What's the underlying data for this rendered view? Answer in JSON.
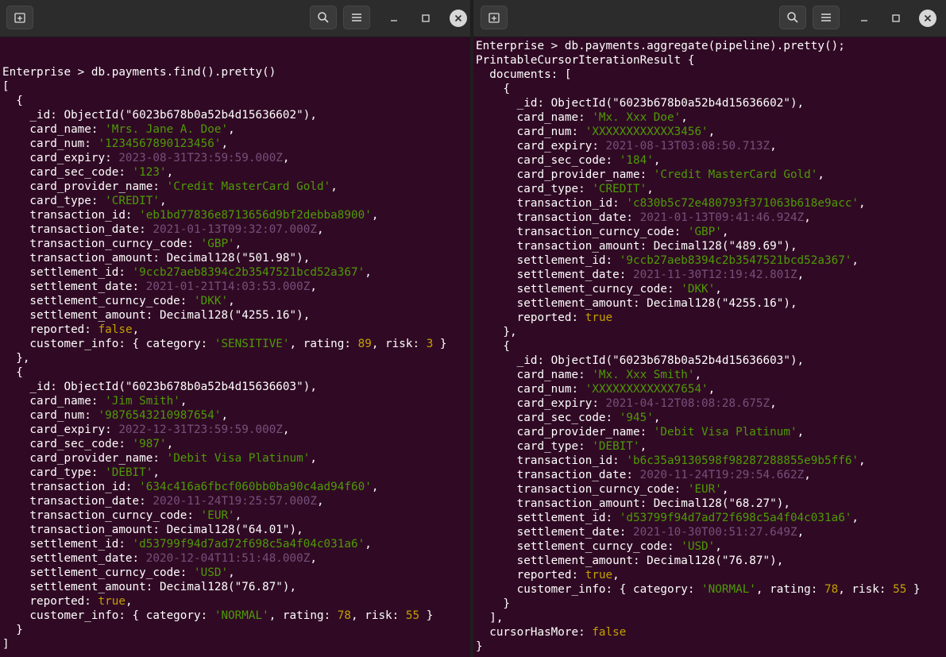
{
  "colors": {
    "terminal_bg": "#300a24",
    "string": "#4e9a06",
    "date": "#75507b",
    "number_bool": "#c4a000",
    "text": "#ffffff",
    "titlebar": "#2c2c2c"
  },
  "icons": [
    "new-tab-icon",
    "search-icon",
    "hamburger-menu-icon",
    "minimize-icon",
    "maximize-icon",
    "close-icon"
  ],
  "left_terminal": {
    "lines": [
      [],
      [
        {
          "t": "Enterprise > db.payments.find().pretty()"
        }
      ],
      [
        {
          "t": "["
        }
      ],
      [
        {
          "t": "  {"
        }
      ],
      [
        {
          "t": "    _id: ObjectId(\"6023b678b0a52b4d15636602\"),"
        }
      ],
      [
        {
          "t": "    card_name: "
        },
        {
          "t": "'Mrs. Jane A. Doe'",
          "c": "s"
        },
        {
          "t": ","
        }
      ],
      [
        {
          "t": "    card_num: "
        },
        {
          "t": "'1234567890123456'",
          "c": "s"
        },
        {
          "t": ","
        }
      ],
      [
        {
          "t": "    card_expiry: "
        },
        {
          "t": "2023-08-31T23:59:59.000Z",
          "c": "d"
        },
        {
          "t": ","
        }
      ],
      [
        {
          "t": "    card_sec_code: "
        },
        {
          "t": "'123'",
          "c": "s"
        },
        {
          "t": ","
        }
      ],
      [
        {
          "t": "    card_provider_name: "
        },
        {
          "t": "'Credit MasterCard Gold'",
          "c": "s"
        },
        {
          "t": ","
        }
      ],
      [
        {
          "t": "    card_type: "
        },
        {
          "t": "'CREDIT'",
          "c": "s"
        },
        {
          "t": ","
        }
      ],
      [
        {
          "t": "    transaction_id: "
        },
        {
          "t": "'eb1bd77836e8713656d9bf2debba8900'",
          "c": "s"
        },
        {
          "t": ","
        }
      ],
      [
        {
          "t": "    transaction_date: "
        },
        {
          "t": "2021-01-13T09:32:07.000Z",
          "c": "d"
        },
        {
          "t": ","
        }
      ],
      [
        {
          "t": "    transaction_curncy_code: "
        },
        {
          "t": "'GBP'",
          "c": "s"
        },
        {
          "t": ","
        }
      ],
      [
        {
          "t": "    transaction_amount: Decimal128(\"501.98\"),"
        }
      ],
      [
        {
          "t": "    settlement_id: "
        },
        {
          "t": "'9ccb27aeb8394c2b3547521bcd52a367'",
          "c": "s"
        },
        {
          "t": ","
        }
      ],
      [
        {
          "t": "    settlement_date: "
        },
        {
          "t": "2021-01-21T14:03:53.000Z",
          "c": "d"
        },
        {
          "t": ","
        }
      ],
      [
        {
          "t": "    settlement_curncy_code: "
        },
        {
          "t": "'DKK'",
          "c": "s"
        },
        {
          "t": ","
        }
      ],
      [
        {
          "t": "    settlement_amount: Decimal128(\"4255.16\"),"
        }
      ],
      [
        {
          "t": "    reported: "
        },
        {
          "t": "false",
          "c": "n"
        },
        {
          "t": ","
        }
      ],
      [
        {
          "t": "    customer_info: { category: "
        },
        {
          "t": "'SENSITIVE'",
          "c": "s"
        },
        {
          "t": ", rating: "
        },
        {
          "t": "89",
          "c": "n"
        },
        {
          "t": ", risk: "
        },
        {
          "t": "3",
          "c": "n"
        },
        {
          "t": " }"
        }
      ],
      [
        {
          "t": "  },"
        }
      ],
      [
        {
          "t": "  {"
        }
      ],
      [
        {
          "t": "    _id: ObjectId(\"6023b678b0a52b4d15636603\"),"
        }
      ],
      [
        {
          "t": "    card_name: "
        },
        {
          "t": "'Jim Smith'",
          "c": "s"
        },
        {
          "t": ","
        }
      ],
      [
        {
          "t": "    card_num: "
        },
        {
          "t": "'9876543210987654'",
          "c": "s"
        },
        {
          "t": ","
        }
      ],
      [
        {
          "t": "    card_expiry: "
        },
        {
          "t": "2022-12-31T23:59:59.000Z",
          "c": "d"
        },
        {
          "t": ","
        }
      ],
      [
        {
          "t": "    card_sec_code: "
        },
        {
          "t": "'987'",
          "c": "s"
        },
        {
          "t": ","
        }
      ],
      [
        {
          "t": "    card_provider_name: "
        },
        {
          "t": "'Debit Visa Platinum'",
          "c": "s"
        },
        {
          "t": ","
        }
      ],
      [
        {
          "t": "    card_type: "
        },
        {
          "t": "'DEBIT'",
          "c": "s"
        },
        {
          "t": ","
        }
      ],
      [
        {
          "t": "    transaction_id: "
        },
        {
          "t": "'634c416a6fbcf060bb0ba90c4ad94f60'",
          "c": "s"
        },
        {
          "t": ","
        }
      ],
      [
        {
          "t": "    transaction_date: "
        },
        {
          "t": "2020-11-24T19:25:57.000Z",
          "c": "d"
        },
        {
          "t": ","
        }
      ],
      [
        {
          "t": "    transaction_curncy_code: "
        },
        {
          "t": "'EUR'",
          "c": "s"
        },
        {
          "t": ","
        }
      ],
      [
        {
          "t": "    transaction_amount: Decimal128(\"64.01\"),"
        }
      ],
      [
        {
          "t": "    settlement_id: "
        },
        {
          "t": "'d53799f94d7ad72f698c5a4f04c031a6'",
          "c": "s"
        },
        {
          "t": ","
        }
      ],
      [
        {
          "t": "    settlement_date: "
        },
        {
          "t": "2020-12-04T11:51:48.000Z",
          "c": "d"
        },
        {
          "t": ","
        }
      ],
      [
        {
          "t": "    settlement_curncy_code: "
        },
        {
          "t": "'USD'",
          "c": "s"
        },
        {
          "t": ","
        }
      ],
      [
        {
          "t": "    settlement_amount: Decimal128(\"76.87\"),"
        }
      ],
      [
        {
          "t": "    reported: "
        },
        {
          "t": "true",
          "c": "n"
        },
        {
          "t": ","
        }
      ],
      [
        {
          "t": "    customer_info: { category: "
        },
        {
          "t": "'NORMAL'",
          "c": "s"
        },
        {
          "t": ", rating: "
        },
        {
          "t": "78",
          "c": "n"
        },
        {
          "t": ", risk: "
        },
        {
          "t": "55",
          "c": "n"
        },
        {
          "t": " }"
        }
      ],
      [
        {
          "t": "  }"
        }
      ],
      [
        {
          "t": "]"
        }
      ]
    ]
  },
  "right_terminal": {
    "lines": [
      [
        {
          "t": "Enterprise > db.payments.aggregate(pipeline).pretty();"
        }
      ],
      [
        {
          "t": "PrintableCursorIterationResult {"
        }
      ],
      [
        {
          "t": "  documents: ["
        }
      ],
      [
        {
          "t": "    {"
        }
      ],
      [
        {
          "t": "      _id: ObjectId(\"6023b678b0a52b4d15636602\"),"
        }
      ],
      [
        {
          "t": "      card_name: "
        },
        {
          "t": "'Mx. Xxx Doe'",
          "c": "s"
        },
        {
          "t": ","
        }
      ],
      [
        {
          "t": "      card_num: "
        },
        {
          "t": "'XXXXXXXXXXXX3456'",
          "c": "s"
        },
        {
          "t": ","
        }
      ],
      [
        {
          "t": "      card_expiry: "
        },
        {
          "t": "2021-08-13T03:08:50.713Z",
          "c": "d"
        },
        {
          "t": ","
        }
      ],
      [
        {
          "t": "      card_sec_code: "
        },
        {
          "t": "'184'",
          "c": "s"
        },
        {
          "t": ","
        }
      ],
      [
        {
          "t": "      card_provider_name: "
        },
        {
          "t": "'Credit MasterCard Gold'",
          "c": "s"
        },
        {
          "t": ","
        }
      ],
      [
        {
          "t": "      card_type: "
        },
        {
          "t": "'CREDIT'",
          "c": "s"
        },
        {
          "t": ","
        }
      ],
      [
        {
          "t": "      transaction_id: "
        },
        {
          "t": "'c830b5c72e480793f371063b618e9acc'",
          "c": "s"
        },
        {
          "t": ","
        }
      ],
      [
        {
          "t": "      transaction_date: "
        },
        {
          "t": "2021-01-13T09:41:46.924Z",
          "c": "d"
        },
        {
          "t": ","
        }
      ],
      [
        {
          "t": "      transaction_curncy_code: "
        },
        {
          "t": "'GBP'",
          "c": "s"
        },
        {
          "t": ","
        }
      ],
      [
        {
          "t": "      transaction_amount: Decimal128(\"489.69\"),"
        }
      ],
      [
        {
          "t": "      settlement_id: "
        },
        {
          "t": "'9ccb27aeb8394c2b3547521bcd52a367'",
          "c": "s"
        },
        {
          "t": ","
        }
      ],
      [
        {
          "t": "      settlement_date: "
        },
        {
          "t": "2021-11-30T12:19:42.801Z",
          "c": "d"
        },
        {
          "t": ","
        }
      ],
      [
        {
          "t": "      settlement_curncy_code: "
        },
        {
          "t": "'DKK'",
          "c": "s"
        },
        {
          "t": ","
        }
      ],
      [
        {
          "t": "      settlement_amount: Decimal128(\"4255.16\"),"
        }
      ],
      [
        {
          "t": "      reported: "
        },
        {
          "t": "true",
          "c": "n"
        }
      ],
      [
        {
          "t": "    },"
        }
      ],
      [
        {
          "t": "    {"
        }
      ],
      [
        {
          "t": "      _id: ObjectId(\"6023b678b0a52b4d15636603\"),"
        }
      ],
      [
        {
          "t": "      card_name: "
        },
        {
          "t": "'Mx. Xxx Smith'",
          "c": "s"
        },
        {
          "t": ","
        }
      ],
      [
        {
          "t": "      card_num: "
        },
        {
          "t": "'XXXXXXXXXXXX7654'",
          "c": "s"
        },
        {
          "t": ","
        }
      ],
      [
        {
          "t": "      card_expiry: "
        },
        {
          "t": "2021-04-12T08:08:28.675Z",
          "c": "d"
        },
        {
          "t": ","
        }
      ],
      [
        {
          "t": "      card_sec_code: "
        },
        {
          "t": "'945'",
          "c": "s"
        },
        {
          "t": ","
        }
      ],
      [
        {
          "t": "      card_provider_name: "
        },
        {
          "t": "'Debit Visa Platinum'",
          "c": "s"
        },
        {
          "t": ","
        }
      ],
      [
        {
          "t": "      card_type: "
        },
        {
          "t": "'DEBIT'",
          "c": "s"
        },
        {
          "t": ","
        }
      ],
      [
        {
          "t": "      transaction_id: "
        },
        {
          "t": "'b6c35a9130598f98287288855e9b5ff6'",
          "c": "s"
        },
        {
          "t": ","
        }
      ],
      [
        {
          "t": "      transaction_date: "
        },
        {
          "t": "2020-11-24T19:29:54.662Z",
          "c": "d"
        },
        {
          "t": ","
        }
      ],
      [
        {
          "t": "      transaction_curncy_code: "
        },
        {
          "t": "'EUR'",
          "c": "s"
        },
        {
          "t": ","
        }
      ],
      [
        {
          "t": "      transaction_amount: Decimal128(\"68.27\"),"
        }
      ],
      [
        {
          "t": "      settlement_id: "
        },
        {
          "t": "'d53799f94d7ad72f698c5a4f04c031a6'",
          "c": "s"
        },
        {
          "t": ","
        }
      ],
      [
        {
          "t": "      settlement_date: "
        },
        {
          "t": "2021-10-30T00:51:27.649Z",
          "c": "d"
        },
        {
          "t": ","
        }
      ],
      [
        {
          "t": "      settlement_curncy_code: "
        },
        {
          "t": "'USD'",
          "c": "s"
        },
        {
          "t": ","
        }
      ],
      [
        {
          "t": "      settlement_amount: Decimal128(\"76.87\"),"
        }
      ],
      [
        {
          "t": "      reported: "
        },
        {
          "t": "true",
          "c": "n"
        },
        {
          "t": ","
        }
      ],
      [
        {
          "t": "      customer_info: { category: "
        },
        {
          "t": "'NORMAL'",
          "c": "s"
        },
        {
          "t": ", rating: "
        },
        {
          "t": "78",
          "c": "n"
        },
        {
          "t": ", risk: "
        },
        {
          "t": "55",
          "c": "n"
        },
        {
          "t": " }"
        }
      ],
      [
        {
          "t": "    }"
        }
      ],
      [
        {
          "t": "  ],"
        }
      ],
      [
        {
          "t": "  cursorHasMore: "
        },
        {
          "t": "false",
          "c": "n"
        }
      ],
      [
        {
          "t": "}"
        }
      ]
    ]
  }
}
